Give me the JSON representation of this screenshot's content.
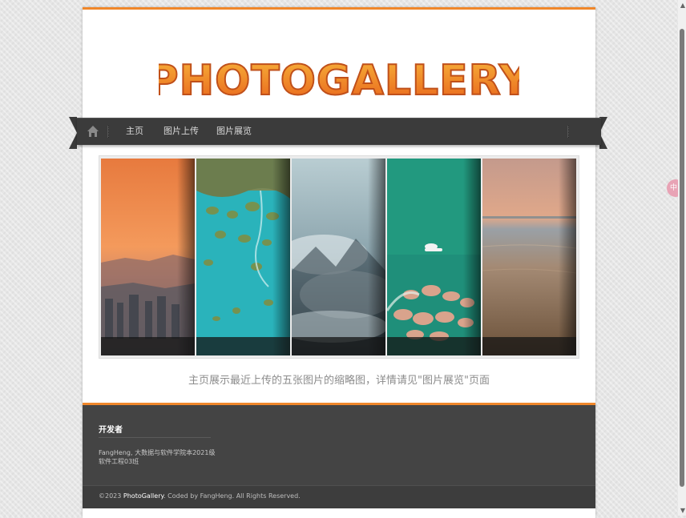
{
  "logo": {
    "text": "PHOTOGALLERY"
  },
  "nav": {
    "items": [
      {
        "label": "主页"
      },
      {
        "label": "图片上传"
      },
      {
        "label": "图片展览"
      }
    ]
  },
  "gallery": {
    "caption": "主页展示最近上传的五张图片的缩略图，详情请见\"图片展览\"页面",
    "images": [
      {
        "name": "sunset-city-thumbnail"
      },
      {
        "name": "aerial-lagoon-thumbnail"
      },
      {
        "name": "misty-mountain-thumbnail"
      },
      {
        "name": "green-sea-boat-thumbnail"
      },
      {
        "name": "beach-dusk-thumbnail"
      }
    ]
  },
  "footer": {
    "title": "开发者",
    "line1": "FangHeng, 大数据与软件学院本2021级",
    "line2": "软件工程03班",
    "copyright_prefix": "©2023 ",
    "copyright_brand": "PhotoGallery",
    "copyright_suffix": ". Coded by FangHeng. All Rights Reserved."
  },
  "side_badge": {
    "label": "中"
  },
  "colors": {
    "accent": "#f0872a",
    "nav_bg": "#3b3b3b",
    "footer_bg": "#444444"
  }
}
